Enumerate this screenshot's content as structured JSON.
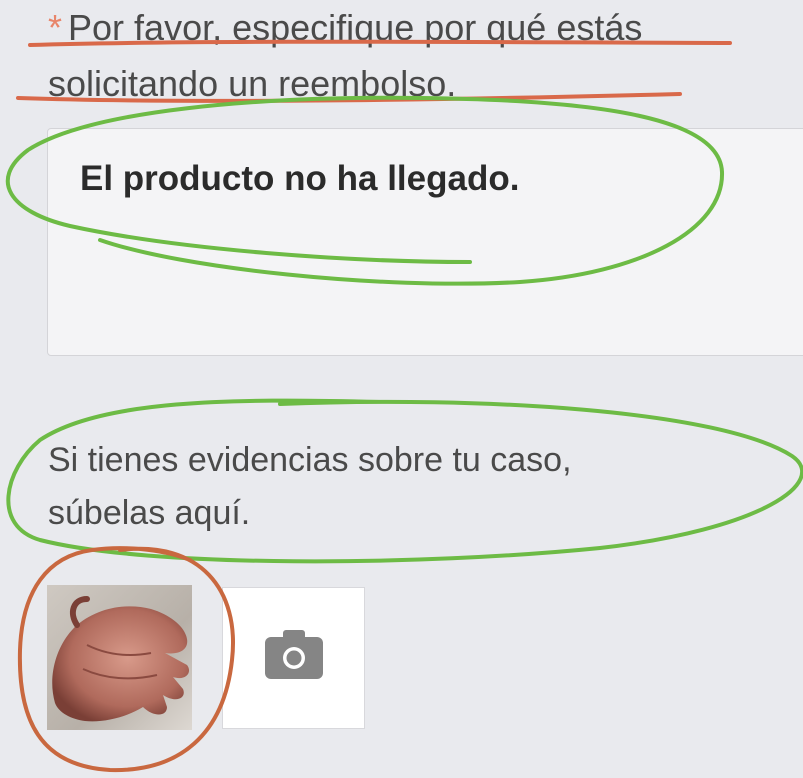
{
  "form": {
    "required_marker": "*",
    "question": "Por favor, especifique por qué estás solicitando un reembolso.",
    "answer": "El producto no ha llegado.",
    "evidence_prompt_line1": "Si tienes evidencias sobre tu caso,",
    "evidence_prompt_line2": "súbelas aquí."
  },
  "upload": {
    "thumbnail_icon": "hand-photo",
    "add_icon": "camera-icon"
  },
  "annotation_colors": {
    "underline": "#d9694a",
    "circle_green": "#6dbb45",
    "circle_orange": "#c9683f"
  }
}
